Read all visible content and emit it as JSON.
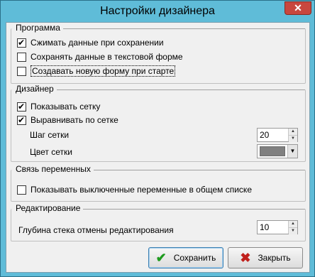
{
  "window": {
    "title": "Настройки дизайнера",
    "close_label": "✕"
  },
  "program": {
    "title": "Программа",
    "items": [
      {
        "label": "Сжимать данные при сохранении",
        "checked": true
      },
      {
        "label": "Сохранять данные в текстовой форме",
        "checked": false
      },
      {
        "label": "Создавать новую форму при старте",
        "checked": false
      }
    ]
  },
  "designer": {
    "title": "Дизайнер",
    "show_grid": {
      "label": "Показывать сетку",
      "checked": true
    },
    "snap_grid": {
      "label": "Выравнивать по сетке",
      "checked": true
    },
    "grid_step": {
      "label": "Шаг сетки",
      "value": "20"
    },
    "grid_color": {
      "label": "Цвет сетки",
      "swatch": "#808080"
    }
  },
  "vars": {
    "title": "Связь переменных",
    "show_disabled": {
      "label": "Показывать выключенные переменные в общем списке",
      "checked": false
    }
  },
  "editing": {
    "title": "Редактирование",
    "undo_depth": {
      "label": "Глубина стека отмены редактирования",
      "value": "10"
    }
  },
  "buttons": {
    "save_label": "Сохранить",
    "save_icon": "check-icon",
    "close_label": "Закрыть",
    "close_icon": "cross-icon"
  },
  "colors": {
    "title_bar": "#5fbcd8",
    "check_green": "#1f9b1f",
    "cross_red": "#c0201c"
  }
}
